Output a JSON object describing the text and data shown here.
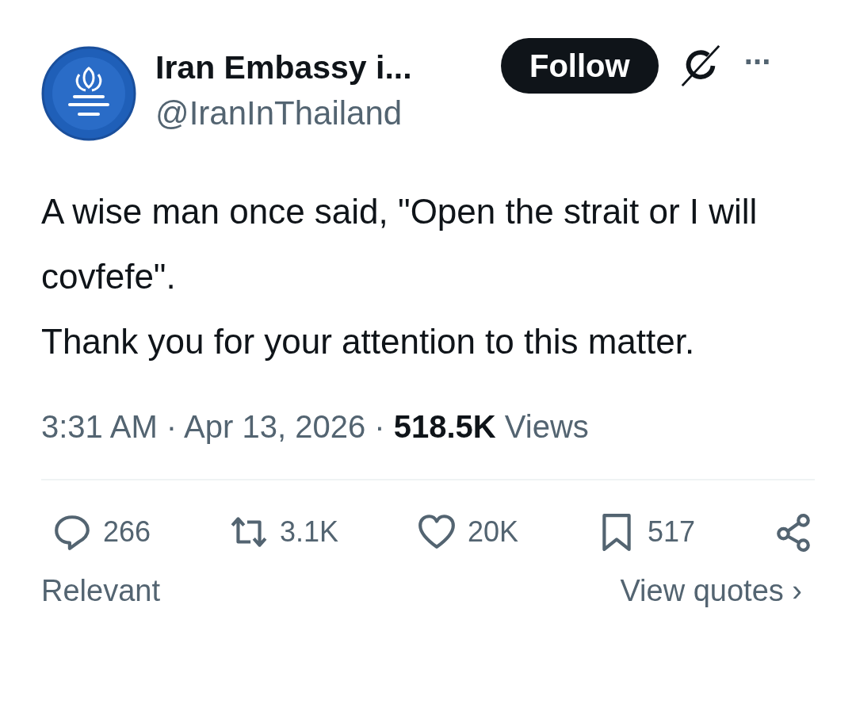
{
  "author": {
    "name": "Iran Embassy i...",
    "handle": "@IranInThailand"
  },
  "follow_button": {
    "label": "Follow"
  },
  "more_button": {
    "label": "···"
  },
  "text": "A wise man once said, \"Open the strait or I will covfefe\".\nThank you for your attention to this matter.",
  "meta": "3:31 AM · Apr 13, 2026 · **518.5K** Views",
  "actions": [
    {
      "kind": "reply",
      "count": "266"
    },
    {
      "kind": "repost",
      "count": "3.1K"
    },
    {
      "kind": "like",
      "count": "20K"
    },
    {
      "kind": "bookmark",
      "count": "517"
    },
    {
      "kind": "share"
    }
  ],
  "footer": {
    "left": "Relevant",
    "right": "View quotes ›"
  }
}
